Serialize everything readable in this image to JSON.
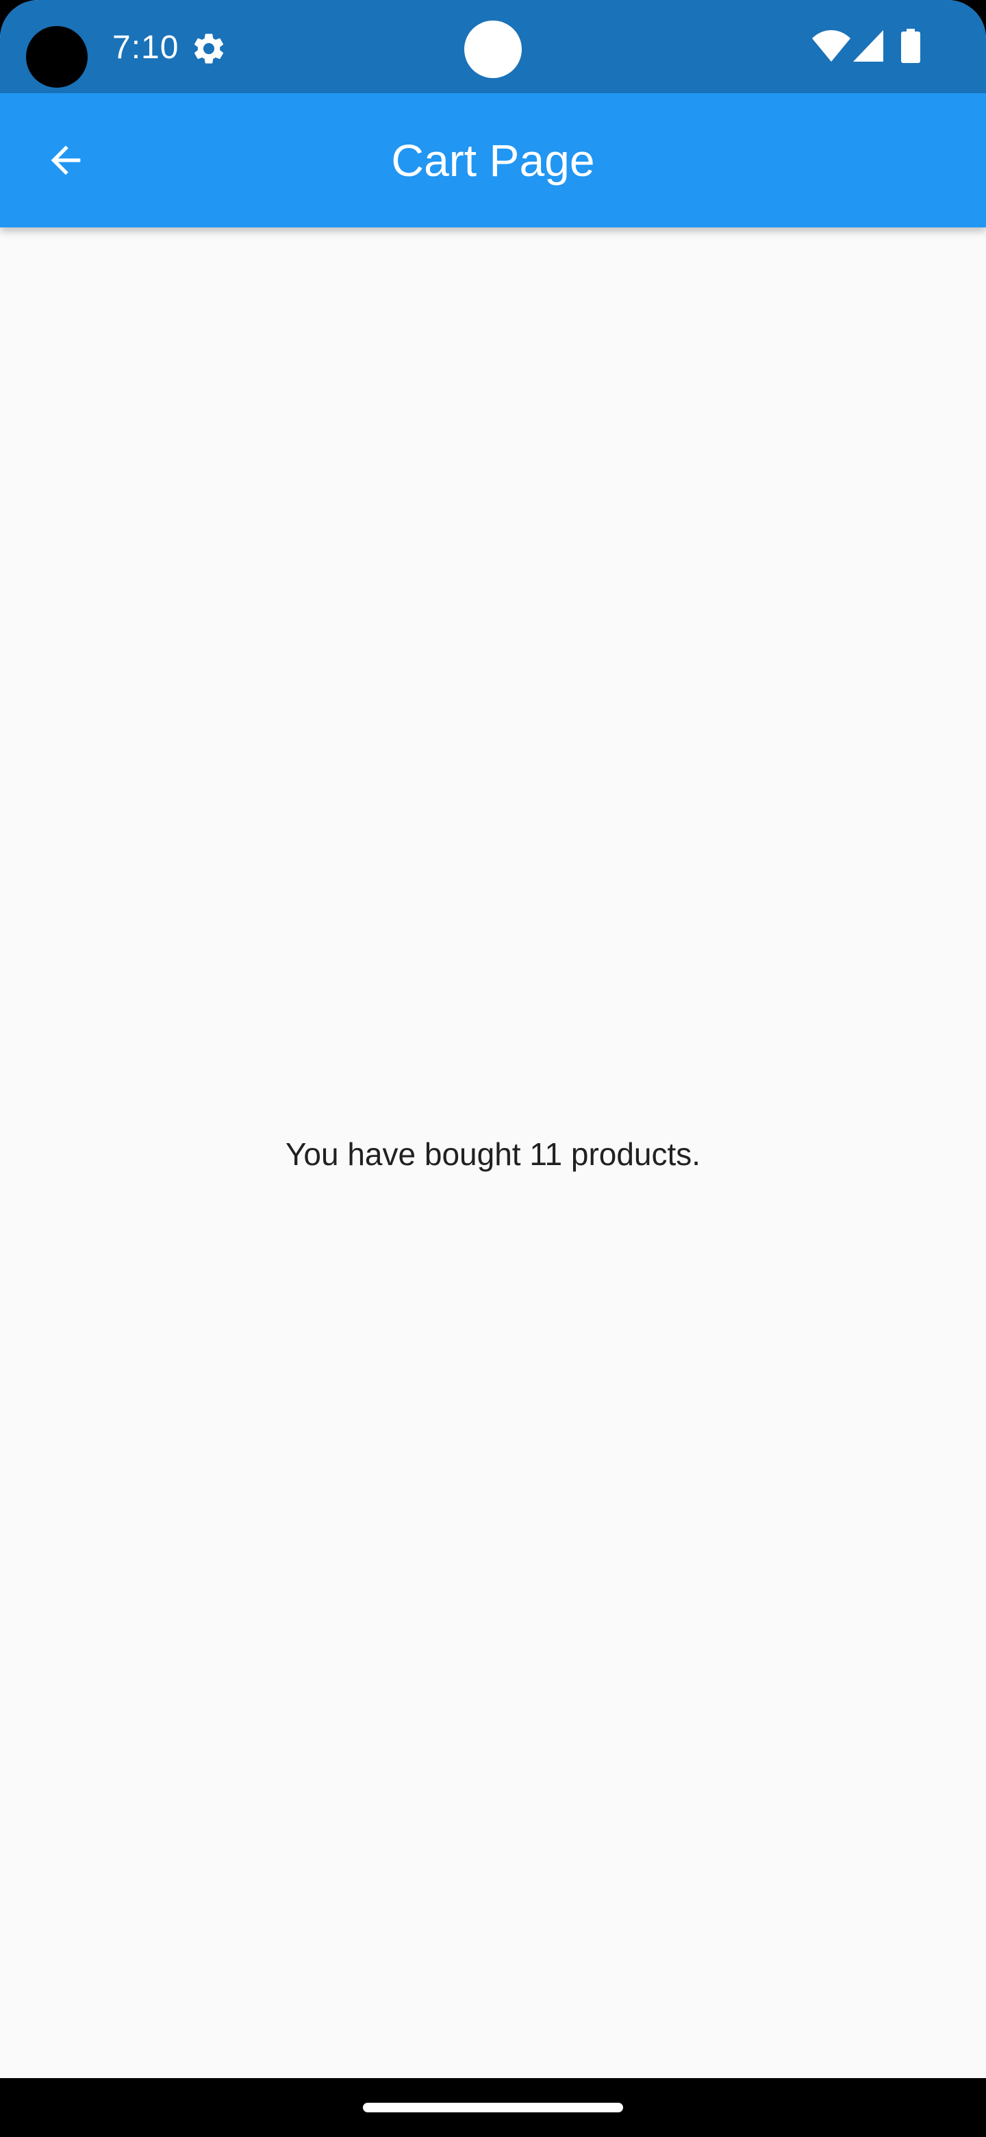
{
  "status_bar": {
    "time": "7:10",
    "icons": [
      "settings-icon",
      "wifi-icon",
      "signal-icon",
      "battery-icon"
    ]
  },
  "app_bar": {
    "title": "Cart Page",
    "back_icon": "arrow-back-icon"
  },
  "main": {
    "message": "You have bought 11 products."
  },
  "colors": {
    "status_bar": "#1a72b9",
    "app_bar": "#2196f3",
    "background": "#fafafa",
    "text": "#212121",
    "nav_bar": "#000000"
  }
}
